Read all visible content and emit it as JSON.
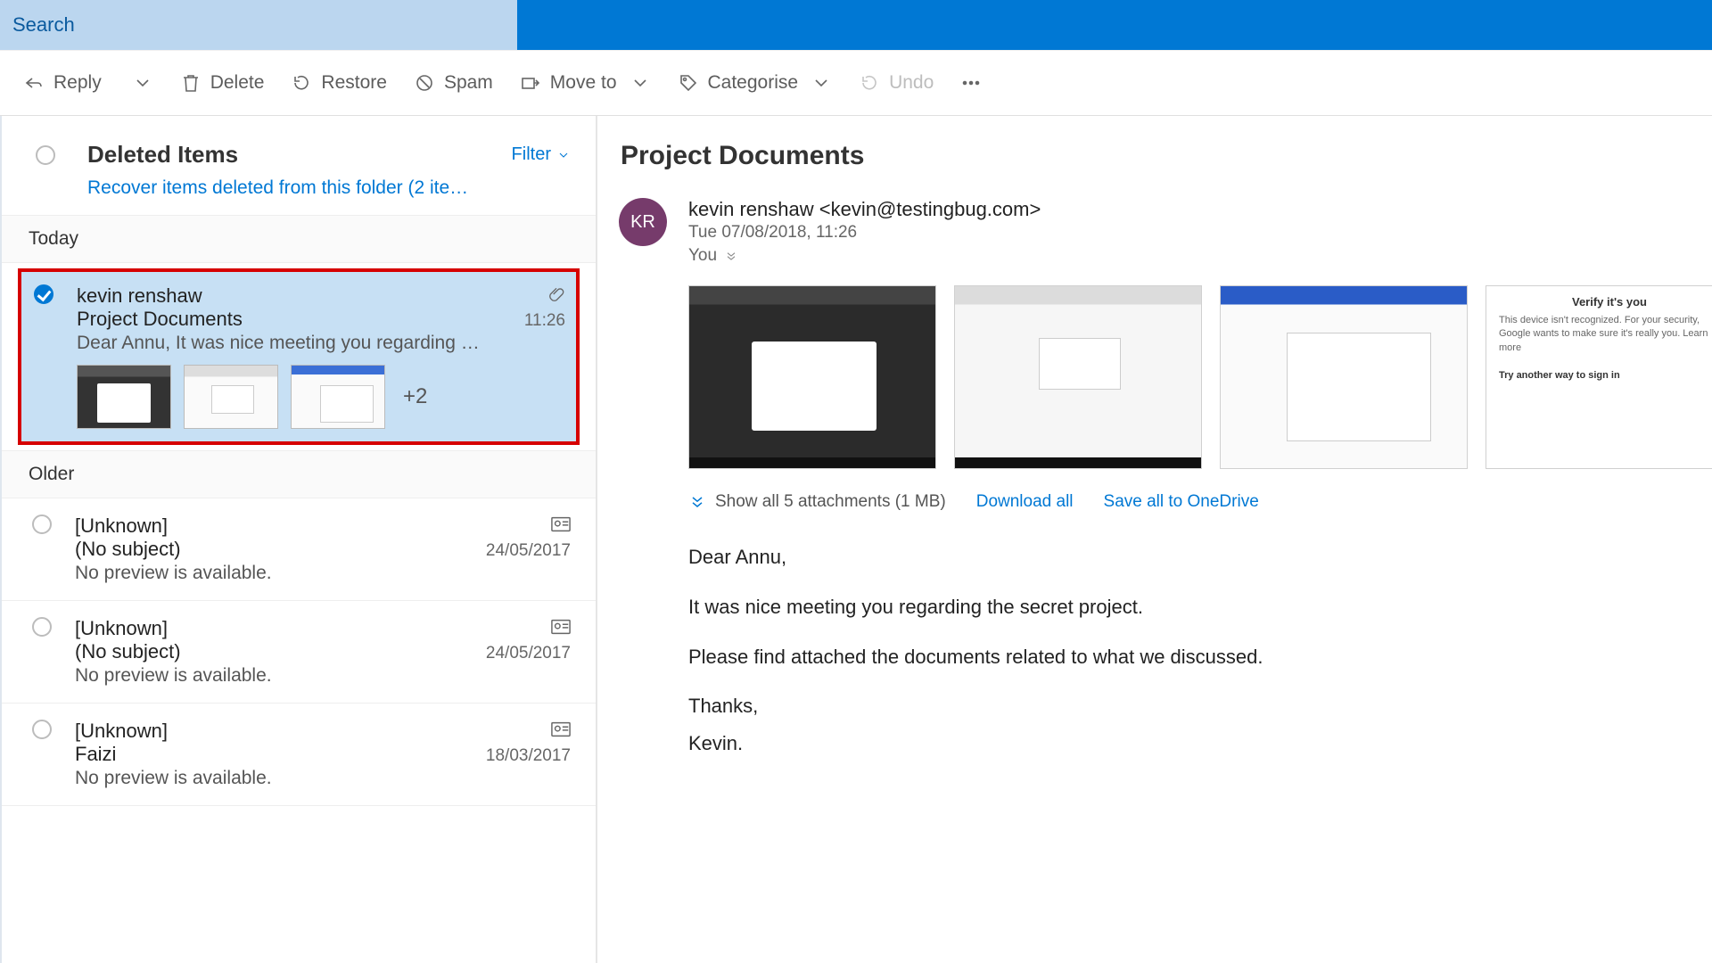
{
  "search": {
    "placeholder": "Search"
  },
  "toolbar": {
    "reply": "Reply",
    "delete": "Delete",
    "restore": "Restore",
    "spam": "Spam",
    "move_to": "Move to",
    "categorise": "Categorise",
    "undo": "Undo"
  },
  "list": {
    "folder_title": "Deleted Items",
    "filter_label": "Filter",
    "recover_link": "Recover items deleted from this folder (2 ite…",
    "sections": {
      "today": "Today",
      "older": "Older"
    },
    "items": [
      {
        "sender": "kevin renshaw",
        "subject": "Project Documents",
        "time": "11:26",
        "preview": "Dear Annu, It was nice meeting you regarding …",
        "selected": true,
        "has_attachment": true,
        "more_attachments": "+2"
      },
      {
        "sender": "[Unknown]",
        "subject": "(No subject)",
        "time": "24/05/2017",
        "preview": "No preview is available.",
        "has_contact_icon": true
      },
      {
        "sender": "[Unknown]",
        "subject": "(No subject)",
        "time": "24/05/2017",
        "preview": "No preview is available.",
        "has_contact_icon": true
      },
      {
        "sender": "[Unknown]",
        "subject": "Faizi",
        "time": "18/03/2017",
        "preview": "No preview is available.",
        "has_contact_icon": true
      }
    ]
  },
  "read": {
    "title": "Project Documents",
    "avatar_initials": "KR",
    "from_display": "kevin renshaw <kevin@testingbug.com>",
    "sent_label": "Tue 07/08/2018, 11:26",
    "to_label": "You",
    "att_preview4": {
      "heading": "Verify it's you",
      "line1": "This device isn't recognized. For your security, Google wants to make sure it's really you. Learn more",
      "line2": "Try another way to sign in"
    },
    "show_all_attachments": "Show all 5 attachments (1 MB)",
    "download_all": "Download all",
    "save_onedrive": "Save all to OneDrive",
    "body": {
      "p1": "Dear Annu,",
      "p2": "It was nice meeting you regarding the secret project.",
      "p3": "Please find attached the documents related to what we discussed.",
      "p4": "Thanks,",
      "p5": "Kevin."
    }
  }
}
